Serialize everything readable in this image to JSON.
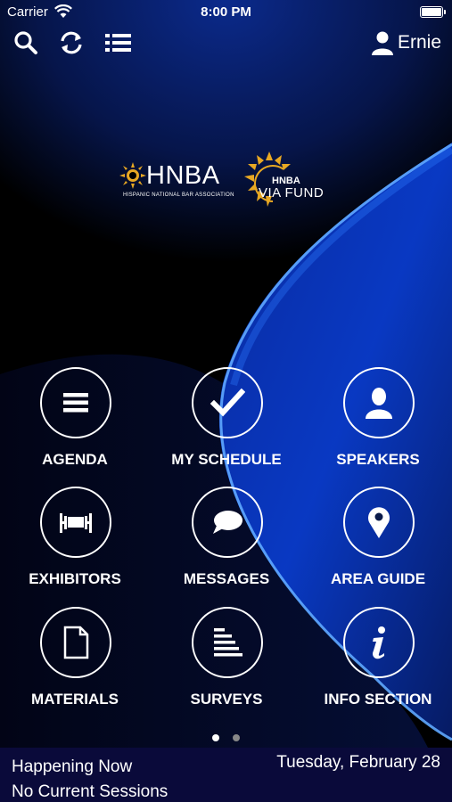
{
  "status_bar": {
    "carrier": "Carrier",
    "time": "8:00 PM"
  },
  "header": {
    "user_name": "Ernie",
    "icons": [
      "search-icon",
      "refresh-icon",
      "list-icon",
      "user-icon"
    ]
  },
  "logos": {
    "hnba_title": "HNBA",
    "hnba_subtitle": "HISPANIC NATIONAL BAR ASSOCIATION",
    "via_small": "HNBA",
    "via_fund": "VIA FUND"
  },
  "menu": {
    "agenda": "AGENDA",
    "my_schedule": "MY SCHEDULE",
    "speakers": "SPEAKERS",
    "exhibitors": "EXHIBITORS",
    "messages": "MESSAGES",
    "area_guide": "AREA GUIDE",
    "materials": "MATERIALS",
    "surveys": "SURVEYS",
    "info_section": "INFO SECTION"
  },
  "pagination": {
    "current": 1,
    "total": 2
  },
  "bottom": {
    "happening_now": "Happening Now",
    "no_sessions": "No Current Sessions",
    "date": "Tuesday, February 28"
  },
  "colors": {
    "accent_blue": "#1a6bff",
    "bottom_bar": "#0a0a3a",
    "gold": "#e8a823"
  }
}
